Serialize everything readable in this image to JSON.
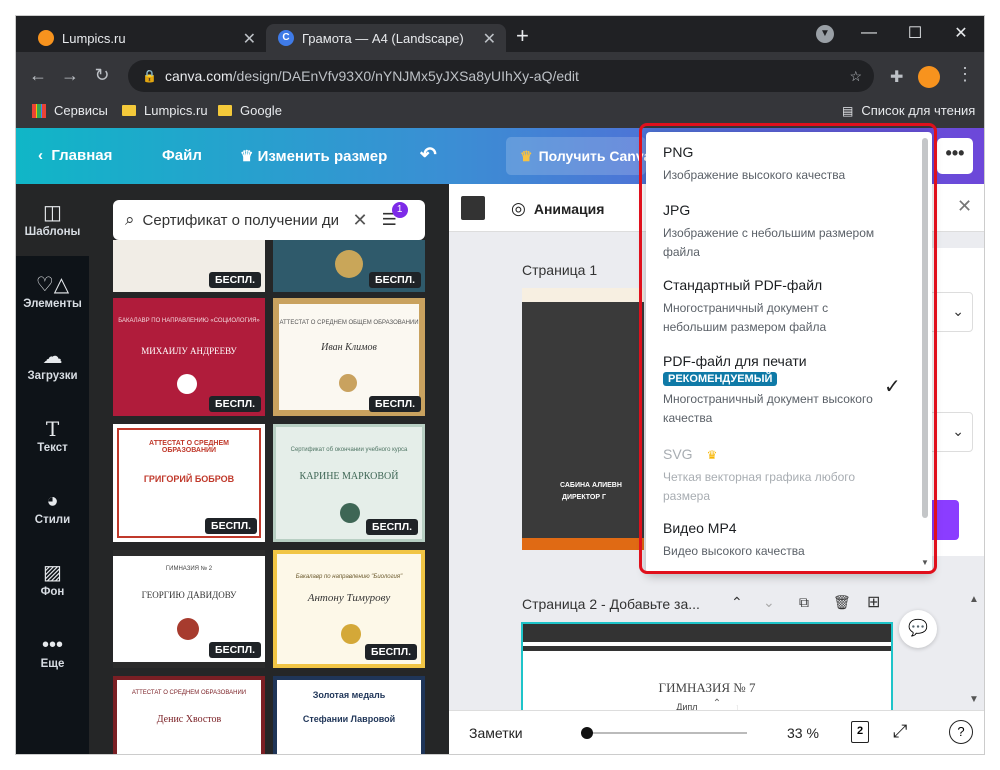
{
  "browser": {
    "tabs": [
      {
        "label": "Lumpics.ru"
      },
      {
        "label": "Грамота — A4 (Landscape)"
      }
    ],
    "url_host": "canva.com",
    "url_path": "/design/DAEnVfv93X0/nYNJMx5yJXSa8yUIhXy-aQ/edit",
    "bookmarks": [
      "Сервисы",
      "Lumpics.ru",
      "Google"
    ],
    "reading_list": "Список для чтения"
  },
  "header": {
    "home": "Главная",
    "file": "Файл",
    "resize": "Изменить размер",
    "get_pro": "Получить Canva"
  },
  "rail": [
    {
      "label": "Шаблоны",
      "icon": "template-icon"
    },
    {
      "label": "Элементы",
      "icon": "elements-icon"
    },
    {
      "label": "Загрузки",
      "icon": "upload-icon"
    },
    {
      "label": "Текст",
      "icon": "text-icon"
    },
    {
      "label": "Стили",
      "icon": "palette-icon"
    },
    {
      "label": "Фон",
      "icon": "background-icon"
    },
    {
      "label": "Еще",
      "icon": "more-icon"
    }
  ],
  "search": {
    "value": "Сертификат о получении ди",
    "filter_count": "1"
  },
  "thumbs": [
    {
      "badge": "БЕСПЛ."
    },
    {
      "badge": "БЕСПЛ."
    },
    {
      "badge": "БЕСПЛ.",
      "title": "МИХАИЛУ АНДРЕЕВУ",
      "top": "БАКАЛАВР ПО НАПРАВЛЕНИЮ «СОЦИОЛОГИЯ»"
    },
    {
      "badge": "БЕСПЛ.",
      "title": "Иван Климов",
      "top": "АТТЕСТАТ О СРЕДНЕМ ОБЩЕМ ОБРАЗОВАНИИ"
    },
    {
      "badge": "БЕСПЛ.",
      "title": "ГРИГОРИЙ БОБРОВ",
      "top": "АТТЕСТАТ О СРЕДНЕМ ОБРАЗОВАНИИ"
    },
    {
      "badge": "БЕСПЛ.",
      "title": "КАРИНЕ МАРКОВОЙ",
      "top": "Сертификат об окончании учебного курса"
    },
    {
      "badge": "БЕСПЛ.",
      "title": "ГЕОРГИЮ ДАВИДОВУ",
      "top": "ГИМНАЗИЯ № 2"
    },
    {
      "badge": "БЕСПЛ.",
      "title": "Антону Тимурову",
      "top": "Бакалавр по направлению \"Биология\""
    },
    {
      "title": "Денис Хвостов",
      "top": "АТТЕСТАТ О СРЕДНЕМ ОБРАЗОВАНИИ"
    },
    {
      "title": "Стефании Лавровой",
      "top": "Золотая медаль"
    }
  ],
  "toolbar": {
    "animation": "Анимация"
  },
  "pages": {
    "page1": "Страница 1",
    "page1_name": "САБИНА АЛИЕВН",
    "page1_role": "ДИРЕКТОР Г",
    "page2": "Страница 2 - Добавьте за...",
    "page2_title": "ГИМНАЗИЯ № 7",
    "page2_sub": "Диплом выдан"
  },
  "bottom": {
    "notes": "Заметки",
    "zoom": "33 %",
    "zoom_level": 0.33,
    "pages_count": "2",
    "help": "?"
  },
  "dropdown": {
    "options": [
      {
        "title": "PNG",
        "desc": "Изображение высокого качества"
      },
      {
        "title": "JPG",
        "desc": "Изображение с небольшим размером файла"
      },
      {
        "title": "Стандартный PDF-файл",
        "desc": "Многостраничный документ с небольшим размером файла"
      },
      {
        "title": "PDF-файл для печати",
        "badge": "РЕКОМЕНДУЕМЫЙ",
        "desc": "Многостраничный документ высокого качества",
        "selected": true
      },
      {
        "title": "SVG",
        "desc": "Четкая векторная графика любого размера",
        "disabled": true
      },
      {
        "title": "Видео MP4",
        "desc": "Видео высокого качества"
      }
    ]
  },
  "colors": {
    "accent": "#8b3dff",
    "highlight": "#e0101c",
    "badge": "#0f7aa7"
  }
}
